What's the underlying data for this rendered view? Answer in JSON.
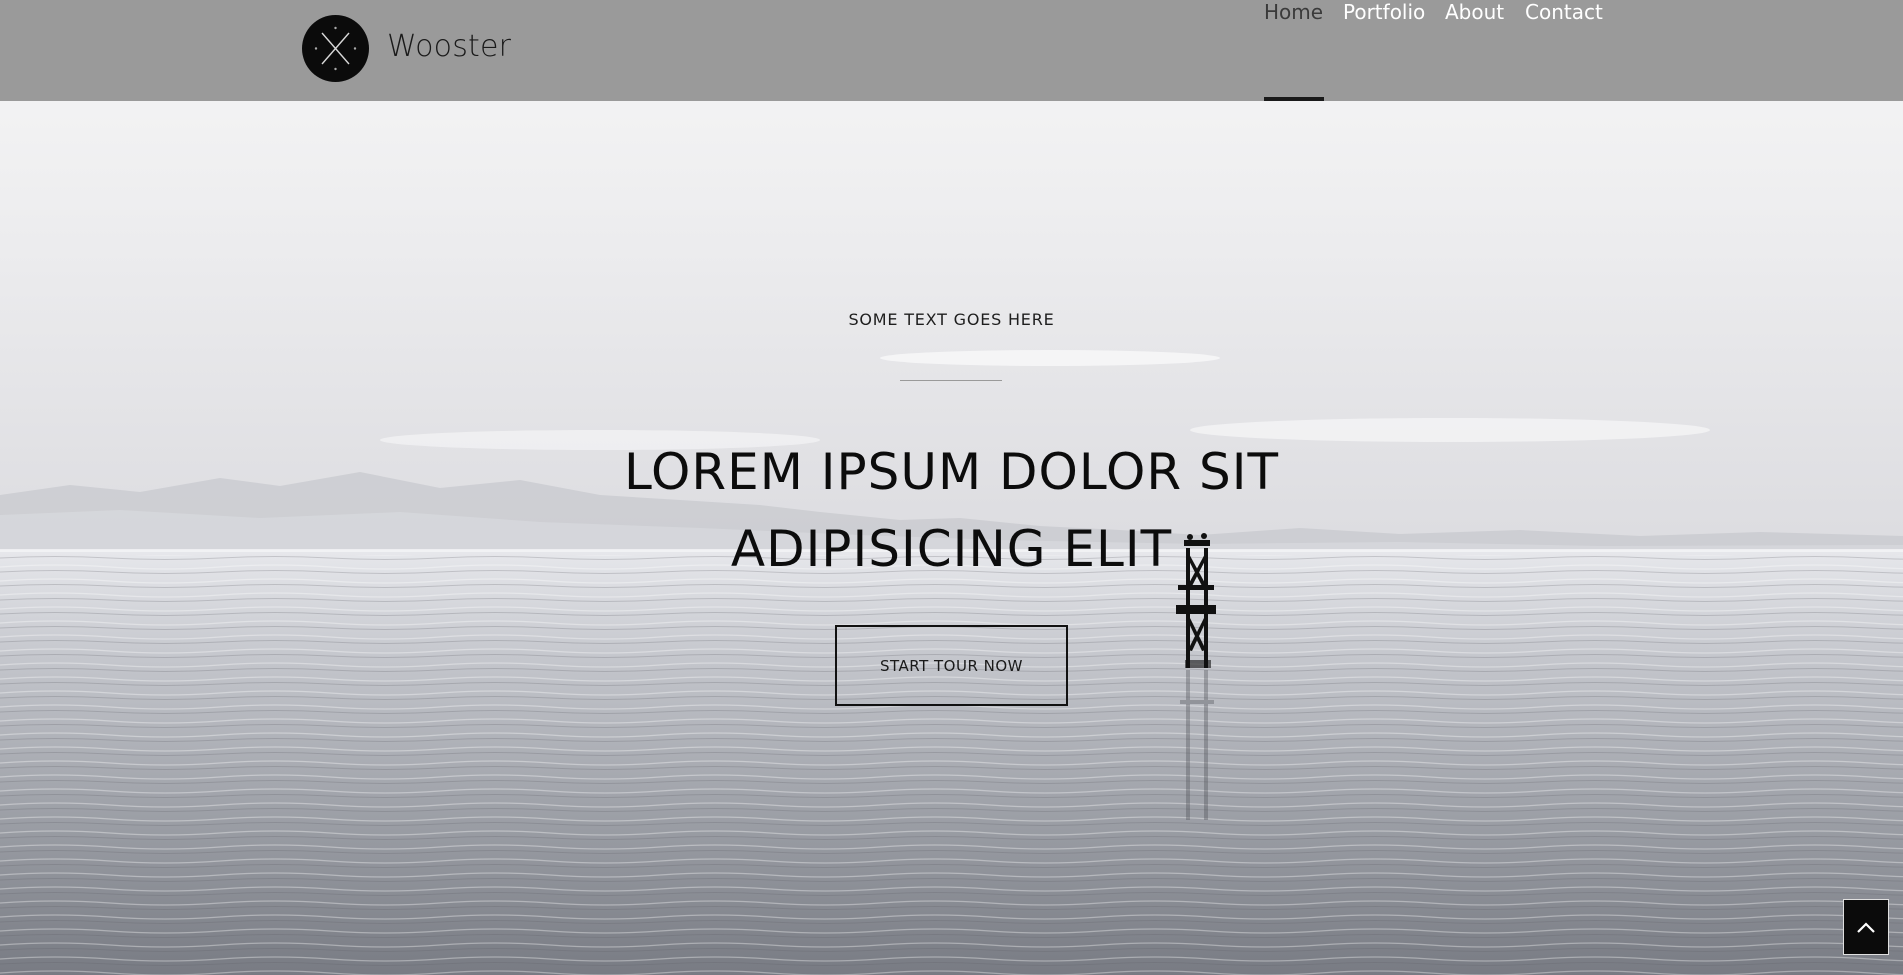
{
  "header": {
    "brand": "Wooster",
    "logo_icon": "crossed-circle-logo",
    "background": "#9a9a9a"
  },
  "nav": {
    "items": [
      {
        "label": "Home",
        "active": true
      },
      {
        "label": "Portfolio",
        "active": false
      },
      {
        "label": "About",
        "active": false
      },
      {
        "label": "Contact",
        "active": false
      }
    ]
  },
  "hero": {
    "kicker": "SOME TEXT GOES HERE",
    "title_line1": "LOREM IPSUM DOLOR SIT",
    "title_line2": "ADIPISICING ELIT",
    "button_label": "START TOUR NOW"
  },
  "scroll_top": {
    "icon": "chevron-up-icon"
  }
}
